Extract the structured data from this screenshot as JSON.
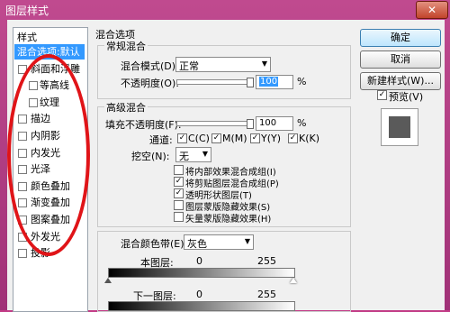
{
  "window": {
    "title": "图层样式",
    "close": "✕"
  },
  "left_panel": {
    "header": "样式",
    "items": [
      {
        "label": "混合选项:默认",
        "selected": true,
        "check": false
      },
      {
        "label": "斜面和浮雕",
        "check": true
      },
      {
        "label": "等高线",
        "check": true,
        "indent": true
      },
      {
        "label": "纹理",
        "check": true,
        "indent": true
      },
      {
        "label": "描边",
        "check": true
      },
      {
        "label": "内阴影",
        "check": true
      },
      {
        "label": "内发光",
        "check": true
      },
      {
        "label": "光泽",
        "check": true
      },
      {
        "label": "颜色叠加",
        "check": true
      },
      {
        "label": "渐变叠加",
        "check": true
      },
      {
        "label": "图案叠加",
        "check": true
      },
      {
        "label": "外发光",
        "check": true
      },
      {
        "label": "投影",
        "check": true
      }
    ]
  },
  "blend_options": {
    "title": "混合选项",
    "general": {
      "title": "常规混合",
      "blend_mode_label": "混合模式(D):",
      "blend_mode_value": "正常",
      "opacity_label": "不透明度(O):",
      "opacity_value": "100",
      "opacity_unit": "%"
    },
    "advanced": {
      "title": "高级混合",
      "fill_opacity_label": "填充不透明度(F):",
      "fill_opacity_value": "100",
      "fill_opacity_unit": "%",
      "channels_label": "通道:",
      "channels": [
        {
          "label": "C(C)",
          "checked": true
        },
        {
          "label": "M(M)",
          "checked": true
        },
        {
          "label": "Y(Y)",
          "checked": true
        },
        {
          "label": "K(K)",
          "checked": true
        }
      ],
      "knockout_label": "挖空(N):",
      "knockout_value": "无",
      "options": [
        {
          "label": "将内部效果混合成组(I)",
          "checked": false
        },
        {
          "label": "将剪贴图层混合成组(P)",
          "checked": true
        },
        {
          "label": "透明形状图层(T)",
          "checked": true
        },
        {
          "label": "图层蒙版隐藏效果(S)",
          "checked": false
        },
        {
          "label": "矢量蒙版隐藏效果(H)",
          "checked": false
        }
      ]
    },
    "blend_if": {
      "label": "混合颜色带(E):",
      "value": "灰色",
      "this_layer": "本图层:",
      "this_min": "0",
      "this_max": "255",
      "under_layer": "下一图层:",
      "under_min": "0",
      "under_max": "255"
    }
  },
  "buttons": {
    "ok": "确定",
    "cancel": "取消",
    "new_style": "新建样式(W)...",
    "preview_label": "预览(V)",
    "preview_checked": true
  },
  "colors": {
    "title_bar": "#c04a8f",
    "selection": "#3399ff",
    "annotation": "#e01418"
  }
}
